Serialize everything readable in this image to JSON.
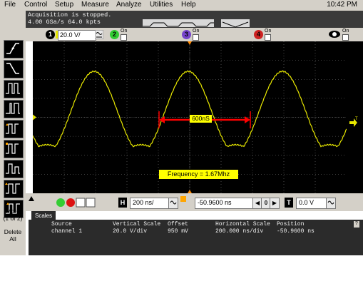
{
  "menu": {
    "items": [
      "File",
      "Control",
      "Setup",
      "Measure",
      "Analyze",
      "Utilities",
      "Help"
    ],
    "clock": "10:42 PM"
  },
  "acquisition": {
    "status": "Acquisition is stopped.",
    "rate": "4.00 GSa/s   64.0 kpts"
  },
  "channels": {
    "ch1": {
      "number": "1",
      "scale": "20.0 V/",
      "color": "#e8e800"
    },
    "ch2": {
      "number": "2",
      "state": "On",
      "color": "#33cc33"
    },
    "ch3": {
      "number": "3",
      "state": "On",
      "color": "#7744cc"
    },
    "ch4": {
      "number": "4",
      "state": "On",
      "color": "#cc2222"
    }
  },
  "side": {
    "more_label_1": "More",
    "more_label_2": "(1 of 2)",
    "delete_label_1": "Delete",
    "delete_label_2": "All"
  },
  "measurements": {
    "period": "600nS",
    "frequency": "Frequency = 1.67Mhz"
  },
  "horizontal": {
    "h_label": "H",
    "timebase": "200 ns/",
    "position": "-50.9600 ns",
    "t_label": "T",
    "trigger_level": "0.0 V",
    "zero_label": "0"
  },
  "scales_tab": "Scales",
  "scales": {
    "headers": [
      "Source",
      "Vertical Scale",
      "Offset",
      "Horizontal Scale",
      "Position"
    ],
    "row": [
      "channel 1",
      "20.0 V/div",
      "950 mV",
      "200.000 ns/div",
      "-50.9600 ns"
    ],
    "help": "?"
  },
  "colors": {
    "trace": "#e8e800",
    "grid": "#7a7a7a",
    "marker": "#ff0000",
    "trigger_arrow": "#ff8800"
  },
  "icons": {
    "trigger_icons": [
      "rising-edge-icon",
      "falling-edge-icon",
      "pulse-width-icon",
      "glitch-icon",
      "pattern-icon",
      "state-icon",
      "runt-icon",
      "setup-hold-icon",
      "transition-icon"
    ]
  }
}
